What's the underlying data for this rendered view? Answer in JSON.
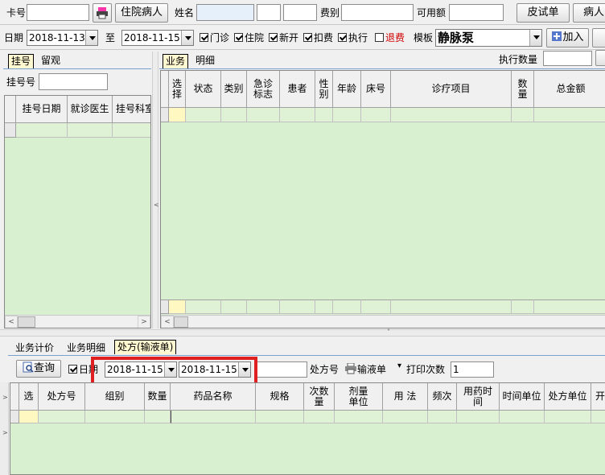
{
  "toolbar1": {
    "card_label": "卡号",
    "inpatient_button": "住院病人",
    "name_label": "姓名",
    "fee_type_label": "费别",
    "available_label": "可用额",
    "skin_test_button": "皮试单",
    "patient_button": "病人"
  },
  "toolbar2": {
    "date_label": "日期",
    "date_from": "2018-11-13",
    "to_label": "至",
    "date_to": "2018-11-15",
    "outpatient": "门诊",
    "inpatient": "住院",
    "new_order": "新开",
    "deduct": "扣费",
    "execute": "执行",
    "refund": "退费",
    "template_label": "模板",
    "template_value": "静脉泵",
    "add_button": "加入"
  },
  "left_panel": {
    "tabs": [
      "挂号",
      "留观"
    ],
    "reg_no_label": "挂号号",
    "columns": [
      "挂号日期",
      "就诊医生",
      "挂号科室"
    ]
  },
  "right_panel": {
    "tabs": [
      "业务",
      "明细"
    ],
    "exec_count_label": "执行数量",
    "columns": [
      "选择",
      "状态",
      "类别",
      "急诊标志",
      "患者",
      "性别",
      "年龄",
      "床号",
      "诊疗项目",
      "数量",
      "总金额"
    ]
  },
  "bottom_panel": {
    "tabs": [
      "业务计价",
      "业务明细",
      "处方(输液单)"
    ],
    "query_button": "查询",
    "date_checkbox": "日期",
    "date_from": "2018-11-15",
    "date_to": "2018-11-15",
    "rx_no_label": "处方号",
    "infusion_button": "输液单",
    "print_count_label": "打印次数",
    "print_count_value": "1",
    "columns": [
      "选",
      "处方号",
      "组别",
      "数量",
      "药品名称",
      "规格",
      "次数量",
      "剂量单位",
      "用 法",
      "频次",
      "用药时间",
      "时间单位",
      "处方单位",
      "开"
    ]
  },
  "colors": {
    "grid_bg": "#d8f0d0",
    "active_tab": "#fff8d0",
    "highlight_box": "#e02020",
    "refund_text": "#d00000"
  },
  "icons": [
    "printer-icon",
    "add-icon",
    "query-icon",
    "infusion-print-icon"
  ]
}
